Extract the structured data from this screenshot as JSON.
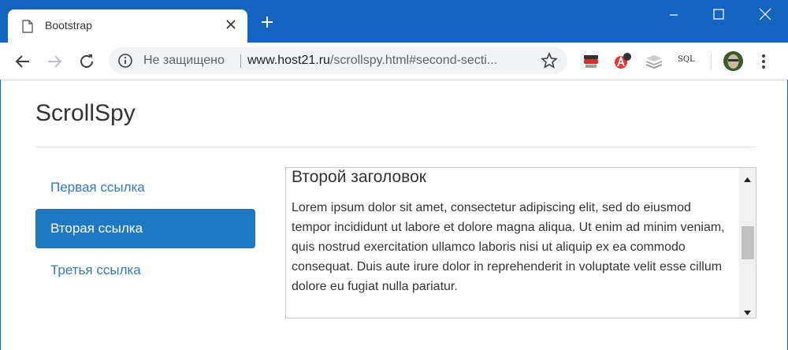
{
  "browser": {
    "tab_title": "Bootstrap",
    "security_label": "Не защищено",
    "url_host": "www.host21.ru",
    "url_path": "/scrollspy.html#second-secti...",
    "extensions": [
      "incognito-mask-icon",
      "adblock-icon",
      "layers-icon",
      "sql-icon"
    ],
    "sql_label": "SQL"
  },
  "page": {
    "title": "ScrollSpy",
    "nav": [
      {
        "label": "Первая ссылка",
        "active": false
      },
      {
        "label": "Вторая ссылка",
        "active": true
      },
      {
        "label": "Третья ссылка",
        "active": false
      }
    ],
    "section_title": "Второй заголовок",
    "section_text": "Lorem ipsum dolor sit amet, consectetur adipiscing elit, sed do eiusmod tempor incididunt ut labore et dolore magna aliqua. Ut enim ad minim veniam, quis nostrud exercitation ullamco laboris nisi ut aliquip ex ea commodo consequat. Duis aute irure dolor in reprehenderit in voluptate velit esse cillum dolore eu fugiat nulla pariatur."
  },
  "colors": {
    "titlebar": "#1565c0",
    "link": "#337ab7",
    "active_bg": "#1f78c4"
  }
}
